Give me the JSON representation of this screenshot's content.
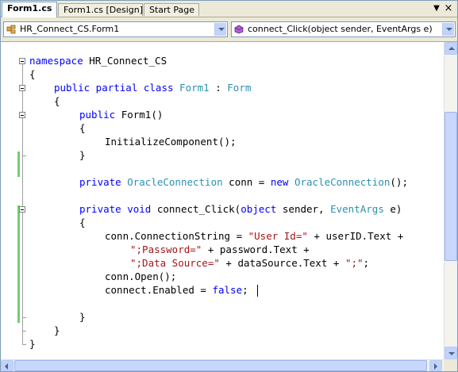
{
  "tabs": [
    {
      "label": "Form1.cs",
      "active": true
    },
    {
      "label": "Form1.cs [Design]",
      "active": false
    },
    {
      "label": "Start Page",
      "active": false
    }
  ],
  "tab_controls": {
    "dropdown_glyph": "▼",
    "close_glyph": "×"
  },
  "class_combo": {
    "value": "HR_Connect_CS.Form1",
    "icon": "class-icon"
  },
  "member_combo": {
    "value": "connect_Click(object sender, EventArgs e)",
    "icon": "method-icon"
  },
  "code": {
    "lines": [
      "namespace HR_Connect_CS",
      "{",
      "public partial class Form1 : Form",
      "{",
      "public Form1()",
      "{",
      "InitializeComponent();",
      "}",
      "",
      "private OracleConnection conn = new OracleConnection();",
      "",
      "private void connect_Click(object sender, EventArgs e)",
      "{",
      "conn.ConnectionString = \"User Id=\" + userID.Text +",
      "\";Password=\" + password.Text +",
      "\";Data Source=\" + dataSource.Text + \";\";",
      "conn.Open();",
      "connect.Enabled = false;",
      "",
      "}",
      "}",
      "}"
    ]
  },
  "colors": {
    "keyword": "#0000ff",
    "type": "#2b91af",
    "string": "#a31515",
    "change_marker": "#6fcf6f"
  }
}
